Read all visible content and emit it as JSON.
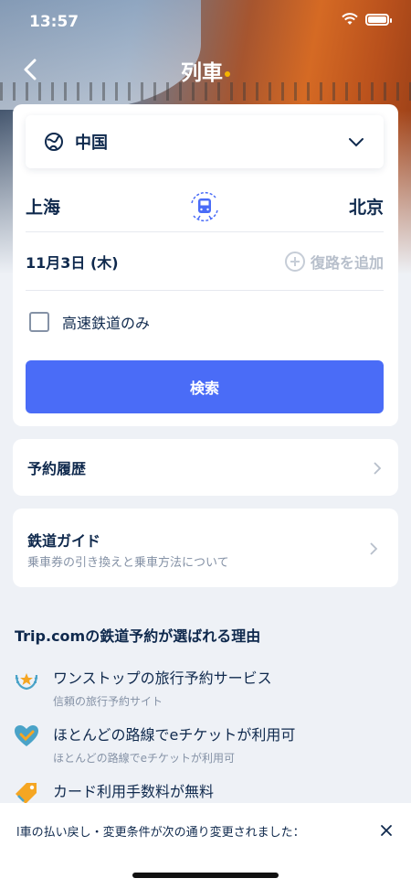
{
  "status_bar": {
    "time": "13:57"
  },
  "header": {
    "title": "列車"
  },
  "search": {
    "country": "中国",
    "from_city": "上海",
    "to_city": "北京",
    "date": "11月3日 (木)",
    "add_return_label": "復路を追加",
    "high_speed_label": "高速鉄道のみ",
    "high_speed_checked": false,
    "search_button": "検索"
  },
  "links": {
    "history_label": "予約履歴",
    "guide_label": "鉄道ガイド",
    "guide_sub": "乗車券の引き換えと乗車方法について"
  },
  "reasons": {
    "title": "Trip.comの鉄道予約が選ばれる理由",
    "items": [
      {
        "title": "ワンストップの旅行予約サービス",
        "sub": "信頼の旅行予約サイト",
        "icon": "laurel-icon"
      },
      {
        "title": "ほとんどの路線でeチケットが利用可",
        "sub": "ほとんどの路線でeチケットが利用可",
        "icon": "heart-check-icon"
      },
      {
        "title": "カード利用手数料が無料",
        "sub": "",
        "icon": "tag-icon"
      }
    ]
  },
  "notice": {
    "text": "l車の払い戻し・変更条件が次の通り変更されました："
  },
  "colors": {
    "accent": "#4a6cf7",
    "text": "#0f294d",
    "muted": "#8592a6"
  }
}
